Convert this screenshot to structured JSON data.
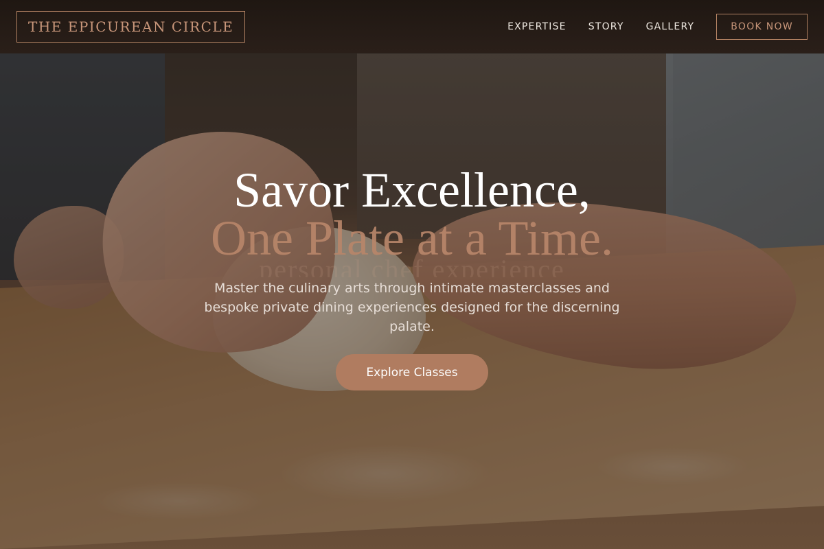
{
  "brand": {
    "name": "THE EPICUREAN CIRCLE"
  },
  "nav": {
    "items": [
      {
        "label": "EXPERTISE"
      },
      {
        "label": "STORY"
      },
      {
        "label": "GALLERY"
      }
    ],
    "cta_label": "BOOK NOW"
  },
  "hero": {
    "headline_line1": "Savor Excellence,",
    "headline_line2": "One Plate at a Time.",
    "ghost_text": "personal chef experience",
    "subtext": "Master the culinary arts through intimate masterclasses and bespoke private dining experiences designed for the discerning palate.",
    "cta_label": "Explore Classes",
    "background_image": "hands-kneading-dough-photo"
  },
  "colors": {
    "accent": "#b07c60",
    "accent_text": "#c8967a",
    "header_bg": "#1f1712",
    "headline_white": "#ffffff",
    "headline_accent": "#b8866a"
  }
}
